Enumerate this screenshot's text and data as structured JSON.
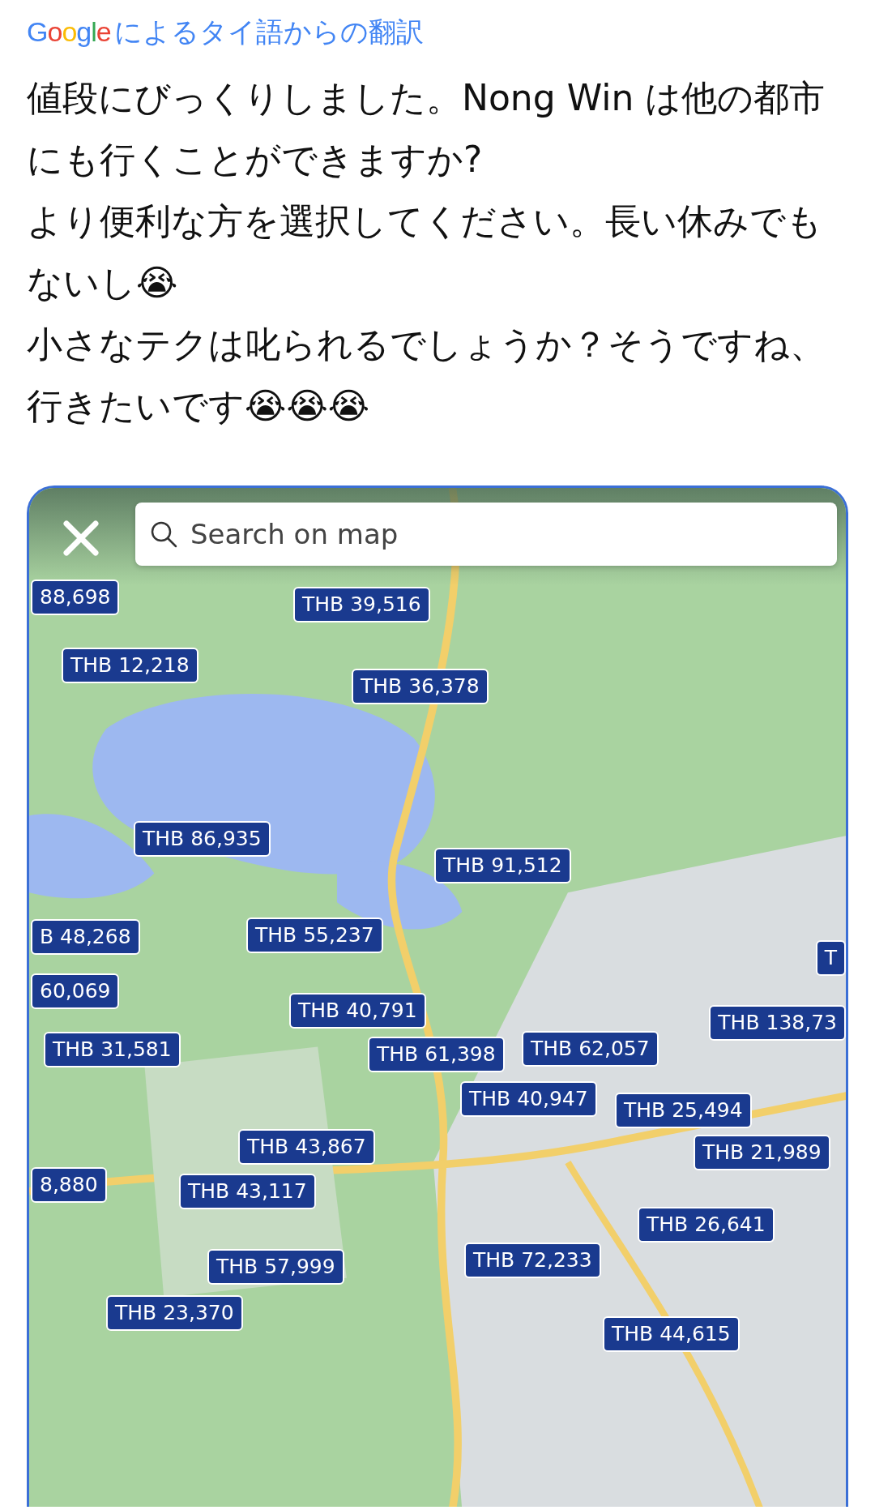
{
  "translation_header": {
    "logo": "Google",
    "label": "によるタイ語からの翻訳"
  },
  "paragraphs": [
    "値段にびっくりしました。Nong Win は他の都市にも行くことができますか?",
    "より便利な方を選択してください。長い休みでもないし😭",
    "小さなテクは叱られるでしょうか？そうですね、行きたいです😭😭😭"
  ],
  "map": {
    "search": {
      "placeholder": "Search on map"
    },
    "price_pins": [
      {
        "label": "88,698"
      },
      {
        "label": "THB 39,516"
      },
      {
        "label": "THB 12,218"
      },
      {
        "label": "THB 36,378"
      },
      {
        "label": "THB 86,935"
      },
      {
        "label": "THB 91,512"
      },
      {
        "label": "B 48,268"
      },
      {
        "label": "60,069"
      },
      {
        "label": "THB 55,237"
      },
      {
        "label": "T"
      },
      {
        "label": "THB 40,791"
      },
      {
        "label": "THB 138,73"
      },
      {
        "label": "THB 31,581"
      },
      {
        "label": "THB 61,398"
      },
      {
        "label": "THB 62,057"
      },
      {
        "label": "THB 40,947"
      },
      {
        "label": "THB 25,494"
      },
      {
        "label": "THB 21,989"
      },
      {
        "label": "THB 43,867"
      },
      {
        "label": "8,880"
      },
      {
        "label": "THB 43,117"
      },
      {
        "label": "THB 26,641"
      },
      {
        "label": "THB 57,999"
      },
      {
        "label": "THB 72,233"
      },
      {
        "label": "THB 23,370"
      },
      {
        "label": "THB 44,615"
      }
    ]
  }
}
